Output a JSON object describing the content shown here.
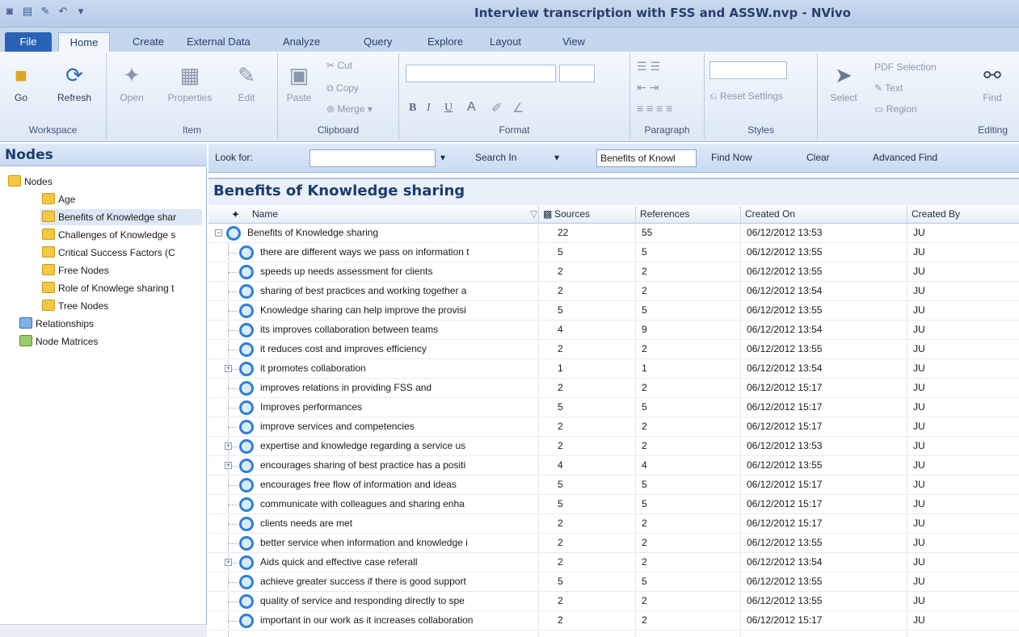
{
  "window": {
    "title": "Interview transcription with FSS and ASSW.nvp - NVivo"
  },
  "tabs": [
    {
      "label": "File"
    },
    {
      "label": "Home"
    },
    {
      "label": "Create"
    },
    {
      "label": "External Data"
    },
    {
      "label": "Analyze"
    },
    {
      "label": "Query"
    },
    {
      "label": "Explore"
    },
    {
      "label": "Layout"
    },
    {
      "label": "View"
    }
  ],
  "ribbon": {
    "workspace": {
      "label": "Workspace",
      "go": "Go",
      "refresh": "Refresh"
    },
    "item": {
      "label": "Item",
      "open": "Open",
      "properties": "Properties",
      "edit": "Edit"
    },
    "clipboard": {
      "label": "Clipboard",
      "paste": "Paste",
      "cut": "Cut",
      "copy": "Copy",
      "merge": "Merge"
    },
    "format": {
      "label": "Format",
      "bold": "B",
      "italic": "I",
      "underline": "U",
      "font_color": "A"
    },
    "paragraph": {
      "label": "Paragraph"
    },
    "styles": {
      "label": "Styles",
      "reset": "Reset Settings"
    },
    "editing": {
      "label": "Editing",
      "select": "Select",
      "pdf_selection": "PDF Selection",
      "text": "Text",
      "region": "Region",
      "find": "Find"
    }
  },
  "nav": {
    "title": "Nodes",
    "items": [
      {
        "label": "Nodes"
      },
      {
        "label": "Age"
      },
      {
        "label": "Benefits of Knowledge shar"
      },
      {
        "label": "Challenges of Knowledge s"
      },
      {
        "label": "Critical Success Factors (C"
      },
      {
        "label": "Free Nodes"
      },
      {
        "label": "Role of Knowlege sharing t"
      },
      {
        "label": "Tree Nodes"
      },
      {
        "label": "Relationships"
      },
      {
        "label": "Node Matrices"
      }
    ]
  },
  "findbar": {
    "look_for": "Look for:",
    "look_for_value": "",
    "search_in": "Search In",
    "search_in_value": "Benefits of Knowl",
    "find_now": "Find Now",
    "clear": "Clear",
    "advanced_find": "Advanced Find"
  },
  "list": {
    "title": "Benefits of Knowledge sharing",
    "columns": {
      "name": "Name",
      "sources": "Sources",
      "references": "References",
      "created_on": "Created On",
      "created_by": "Created By"
    },
    "parent": {
      "name": "Benefits of Knowledge sharing",
      "sources": "22",
      "references": "55",
      "created_on": "06/12/2012 13:53",
      "created_by": "JU"
    },
    "rows": [
      {
        "name": "there are different ways we pass on information t",
        "sources": "5",
        "references": "5",
        "created_on": "06/12/2012 13:55",
        "created_by": "JU"
      },
      {
        "name": "speeds up needs assessment for clients",
        "sources": "2",
        "references": "2",
        "created_on": "06/12/2012 13:55",
        "created_by": "JU"
      },
      {
        "name": "sharing of best practices and working together a",
        "sources": "2",
        "references": "2",
        "created_on": "06/12/2012 13:54",
        "created_by": "JU"
      },
      {
        "name": "Knowledge sharing can help improve the provisi",
        "sources": "5",
        "references": "5",
        "created_on": "06/12/2012 13:55",
        "created_by": "JU"
      },
      {
        "name": "its improves collaboration between teams",
        "sources": "4",
        "references": "9",
        "created_on": "06/12/2012 13:54",
        "created_by": "JU"
      },
      {
        "name": "it reduces cost and improves efficiency",
        "sources": "2",
        "references": "2",
        "created_on": "06/12/2012 13:55",
        "created_by": "JU"
      },
      {
        "name": "it promotes collaboration",
        "sources": "1",
        "references": "1",
        "created_on": "06/12/2012 13:54",
        "created_by": "JU",
        "expandable": true
      },
      {
        "name": "improves relations in providing FSS  and",
        "sources": "2",
        "references": "2",
        "created_on": "06/12/2012 15:17",
        "created_by": "JU"
      },
      {
        "name": "Improves performances",
        "sources": "5",
        "references": "5",
        "created_on": "06/12/2012 15:17",
        "created_by": "JU"
      },
      {
        "name": "improve services and competencies",
        "sources": "2",
        "references": "2",
        "created_on": "06/12/2012 15:17",
        "created_by": "JU"
      },
      {
        "name": "expertise and knowledge regarding a service us",
        "sources": "2",
        "references": "2",
        "created_on": "06/12/2012 13:53",
        "created_by": "JU",
        "expandable": true
      },
      {
        "name": "encourages sharing of best practice has a  positi",
        "sources": "4",
        "references": "4",
        "created_on": "06/12/2012 13:55",
        "created_by": "JU",
        "expandable": true
      },
      {
        "name": "encourages free flow of information and ideas",
        "sources": "5",
        "references": "5",
        "created_on": "06/12/2012 15:17",
        "created_by": "JU"
      },
      {
        "name": "communicate with colleagues and sharing enha",
        "sources": "5",
        "references": "5",
        "created_on": "06/12/2012 15:17",
        "created_by": "JU"
      },
      {
        "name": "clients needs are met",
        "sources": "2",
        "references": "2",
        "created_on": "06/12/2012 15:17",
        "created_by": "JU"
      },
      {
        "name": "better service when information and knowledge i",
        "sources": "2",
        "references": "2",
        "created_on": "06/12/2012 13:55",
        "created_by": "JU"
      },
      {
        "name": "Aids quick and effective case referall",
        "sources": "2",
        "references": "2",
        "created_on": "06/12/2012 13:54",
        "created_by": "JU",
        "expandable": true
      },
      {
        "name": "achieve greater success if there is good support",
        "sources": "5",
        "references": "5",
        "created_on": "06/12/2012 13:55",
        "created_by": "JU"
      },
      {
        "name": " quality of service and responding directly to spe",
        "sources": "2",
        "references": "2",
        "created_on": "06/12/2012 13:55",
        "created_by": "JU"
      },
      {
        "name": " important in our work as it increases collaboration",
        "sources": "2",
        "references": "2",
        "created_on": "06/12/2012 15:17",
        "created_by": "JU"
      }
    ]
  },
  "colors": {
    "accent": "#2a62b6",
    "node_icon": "#2f7fd6",
    "folder": "#f5c842"
  }
}
